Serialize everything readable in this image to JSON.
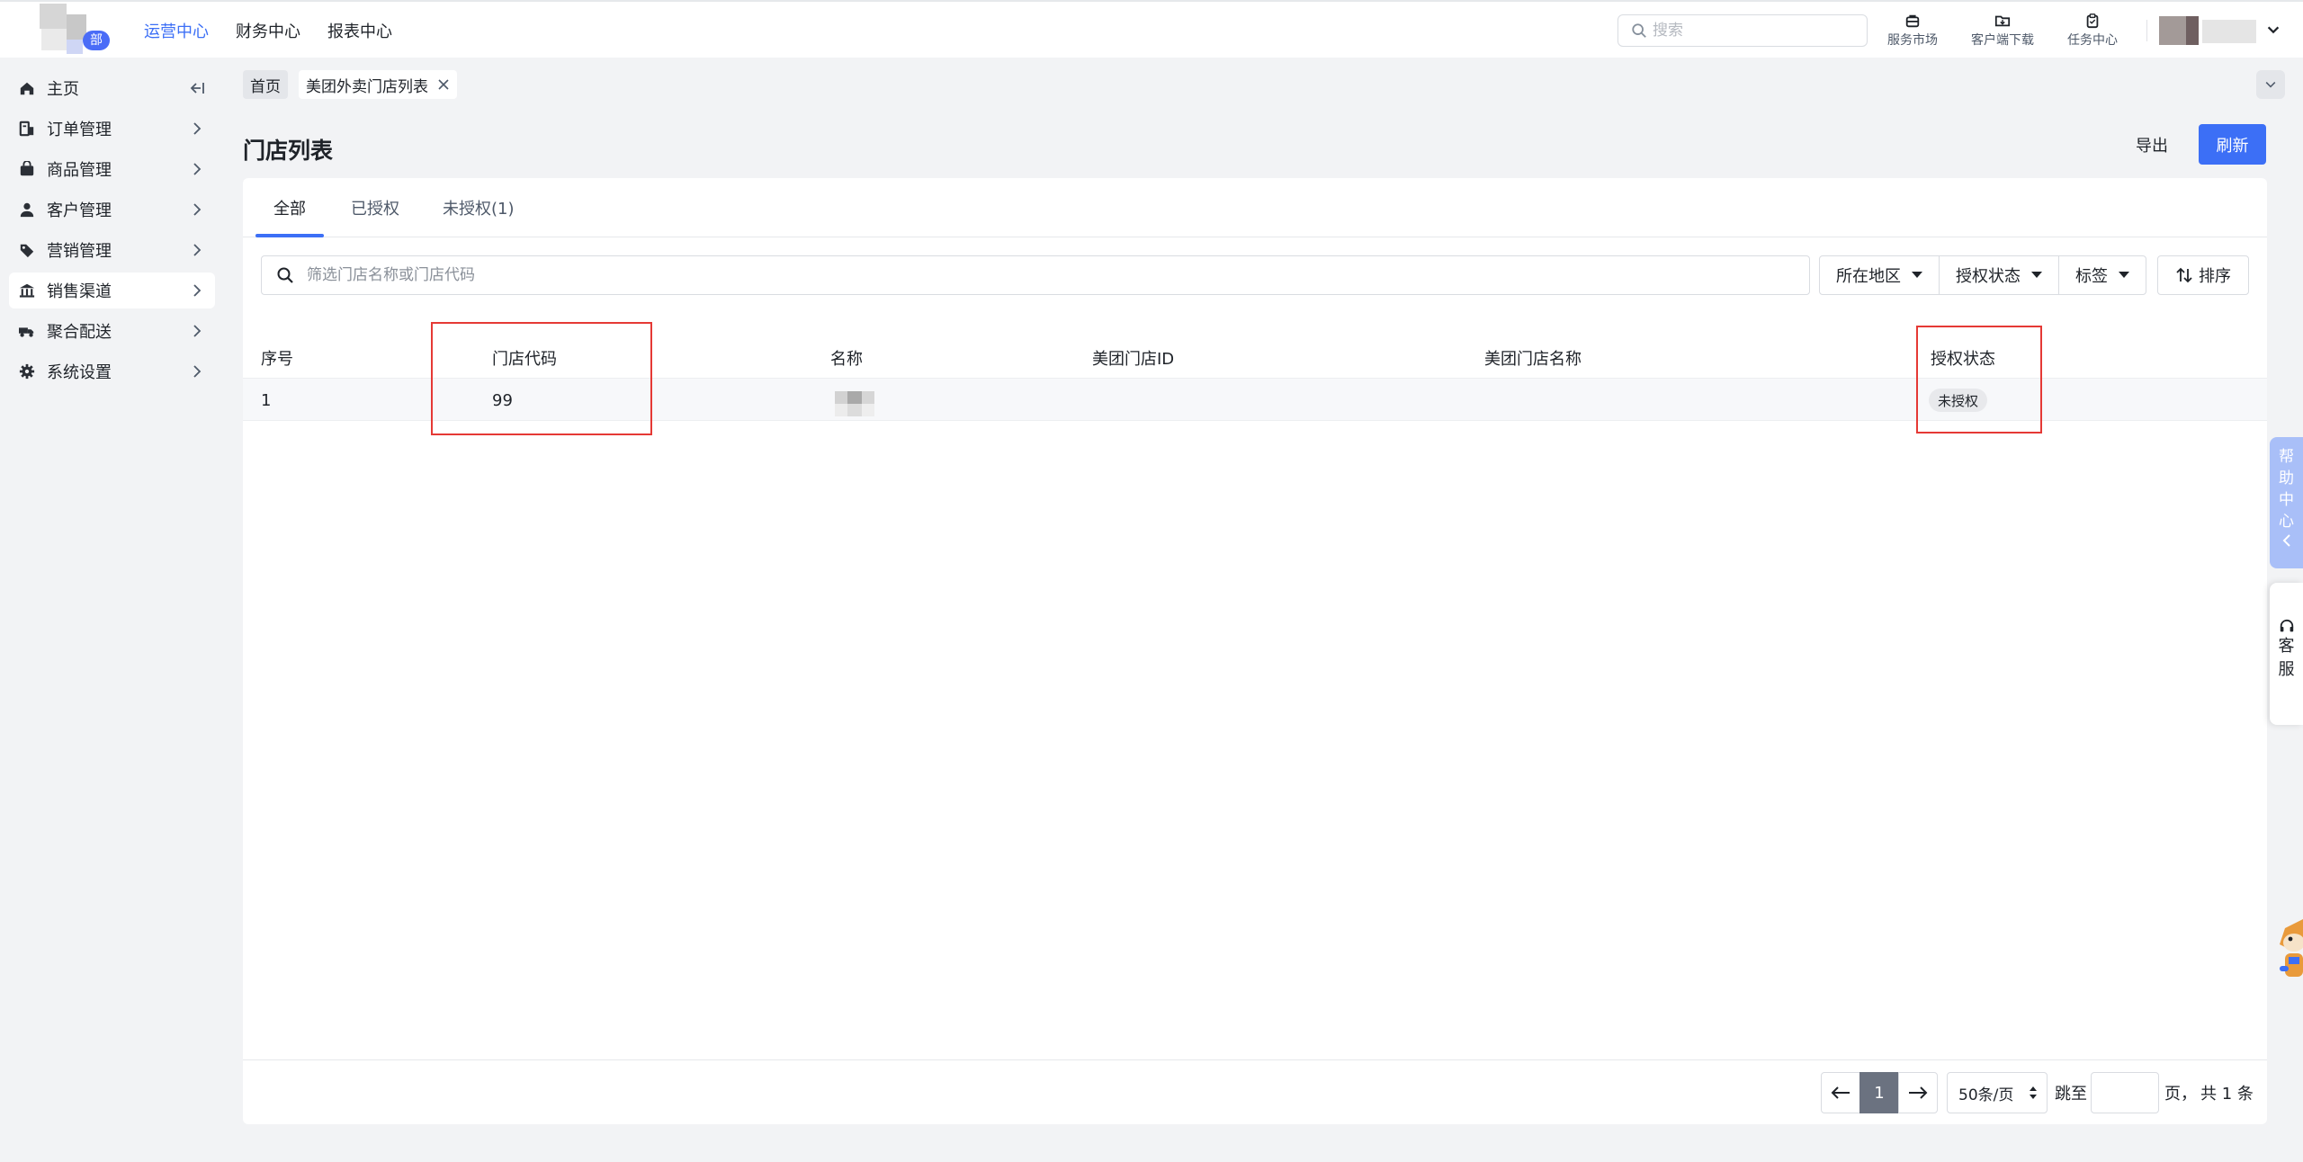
{
  "topbar": {
    "logo_badge": "部",
    "nav": [
      "运营中心",
      "财务中心",
      "报表中心"
    ],
    "search_placeholder": "搜索",
    "tools": [
      {
        "label": "服务市场",
        "icon": "shop-icon"
      },
      {
        "label": "客户端下载",
        "icon": "folder-download-icon"
      },
      {
        "label": "任务中心",
        "icon": "clipboard-icon"
      }
    ]
  },
  "sidebar": {
    "items": [
      {
        "label": "主页",
        "icon": "home-icon"
      },
      {
        "label": "订单管理",
        "icon": "order-icon"
      },
      {
        "label": "商品管理",
        "icon": "bag-icon"
      },
      {
        "label": "客户管理",
        "icon": "user-icon"
      },
      {
        "label": "营销管理",
        "icon": "tag-icon"
      },
      {
        "label": "销售渠道",
        "icon": "bank-icon"
      },
      {
        "label": "聚合配送",
        "icon": "delivery-icon"
      },
      {
        "label": "系统设置",
        "icon": "gear-icon"
      }
    ],
    "active": "销售渠道"
  },
  "breadcrumb": {
    "home": "首页",
    "current": "美团外卖门店列表"
  },
  "page": {
    "title": "门店列表",
    "export": "导出",
    "refresh": "刷新"
  },
  "tabs": [
    "全部",
    "已授权",
    "未授权(1)"
  ],
  "filters": {
    "search_placeholder": "筛选门店名称或门店代码",
    "dropdowns": [
      "所在地区",
      "授权状态",
      "标签"
    ],
    "sort": "排序"
  },
  "table": {
    "columns": [
      "序号",
      "门店代码",
      "名称",
      "美团门店ID",
      "美团门店名称",
      "授权状态"
    ],
    "rows": [
      {
        "index": "1",
        "code": "99",
        "name": "",
        "mt_id": "",
        "mt_name": "",
        "status": "未授权"
      }
    ]
  },
  "pagination": {
    "current_page": "1",
    "page_size": "50条/页",
    "jump_label": "跳至",
    "page_suffix": "页，",
    "total": "共 1 条"
  },
  "floating": {
    "help": [
      "帮",
      "助",
      "中",
      "心"
    ],
    "service": [
      "客",
      "服"
    ]
  },
  "colors": {
    "accent": "#3c6ff6",
    "highlight_box": "#e53935"
  }
}
